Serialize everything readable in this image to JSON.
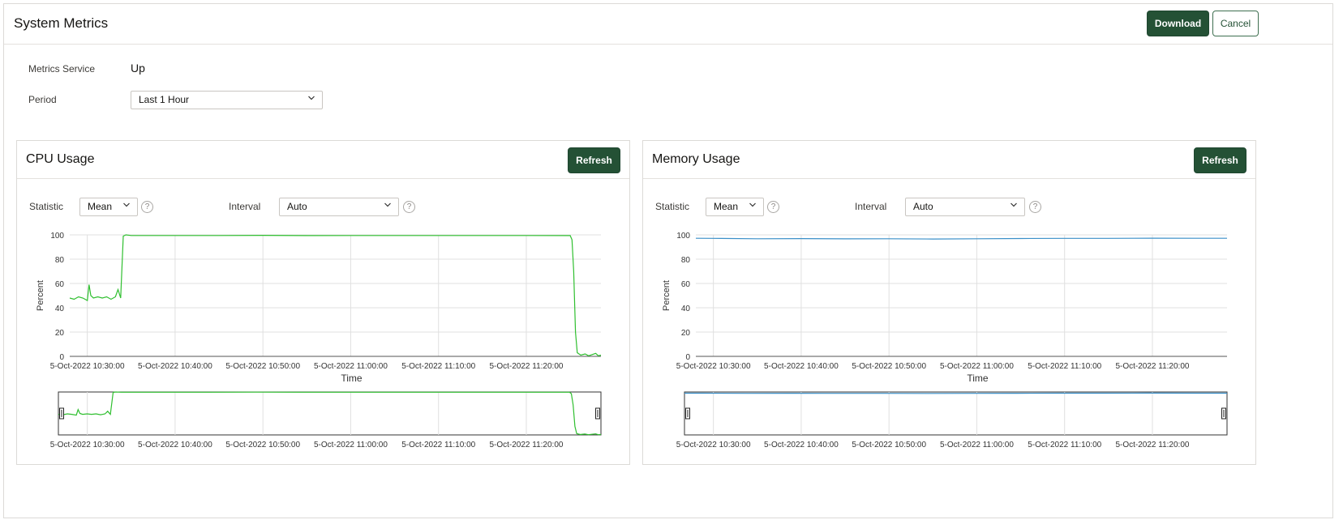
{
  "header": {
    "title": "System Metrics",
    "download_label": "Download",
    "cancel_label": "Cancel"
  },
  "info": {
    "service_label": "Metrics Service",
    "service_value": "Up",
    "period_label": "Period",
    "period_value": "Last 1 Hour"
  },
  "colors": {
    "primary": "#245135",
    "cpu_line": "#2fbf2f",
    "memory_line": "#3a8fc8",
    "grid": "#e0e0e0"
  },
  "icons": {
    "dropdown": "chevron-down-icon",
    "help": "question-circle-icon"
  },
  "panels": [
    {
      "title": "CPU Usage",
      "refresh_label": "Refresh",
      "statistic_label": "Statistic",
      "statistic_value": "Mean",
      "interval_label": "Interval",
      "interval_value": "Auto",
      "help_glyph": "?"
    },
    {
      "title": "Memory Usage",
      "refresh_label": "Refresh",
      "statistic_label": "Statistic",
      "statistic_value": "Mean",
      "interval_label": "Interval",
      "interval_value": "Auto",
      "help_glyph": "?"
    }
  ],
  "chart_data": [
    {
      "type": "line",
      "title": "",
      "xlabel": "Time",
      "ylabel": "Percent",
      "ylim": [
        0,
        100
      ],
      "yticks": [
        0,
        20,
        40,
        60,
        80,
        100
      ],
      "xlim_minutes": [
        -2,
        58.5
      ],
      "xticks": [
        {
          "label": "5-Oct-2022 10:30:00",
          "minute": 0
        },
        {
          "label": "5-Oct-2022 10:40:00",
          "minute": 10
        },
        {
          "label": "5-Oct-2022 10:50:00",
          "minute": 20
        },
        {
          "label": "5-Oct-2022 11:00:00",
          "minute": 30
        },
        {
          "label": "5-Oct-2022 11:10:00",
          "minute": 40
        },
        {
          "label": "5-Oct-2022 11:20:00",
          "minute": 50
        }
      ],
      "grid": true,
      "series": [
        {
          "color": "#2fbf2f",
          "points": [
            [
              -2,
              48
            ],
            [
              -1.5,
              47
            ],
            [
              -1,
              49
            ],
            [
              -0.5,
              48
            ],
            [
              0,
              46
            ],
            [
              0.2,
              59
            ],
            [
              0.4,
              50
            ],
            [
              0.7,
              48
            ],
            [
              1.2,
              49
            ],
            [
              1.7,
              48
            ],
            [
              2.2,
              49
            ],
            [
              2.7,
              47
            ],
            [
              3.2,
              49
            ],
            [
              3.5,
              55
            ],
            [
              3.8,
              48
            ],
            [
              4.1,
              99
            ],
            [
              4.4,
              100
            ],
            [
              5,
              99.5
            ],
            [
              10,
              99.5
            ],
            [
              15,
              99.5
            ],
            [
              20,
              99.6
            ],
            [
              25,
              99.4
            ],
            [
              30,
              99.5
            ],
            [
              35,
              99.5
            ],
            [
              40,
              99.5
            ],
            [
              45,
              99.5
            ],
            [
              50,
              99.5
            ],
            [
              55,
              99.4
            ],
            [
              55.2,
              96
            ],
            [
              55.4,
              70
            ],
            [
              55.6,
              20
            ],
            [
              55.8,
              3
            ],
            [
              56.2,
              1
            ],
            [
              56.7,
              2
            ],
            [
              57.1,
              0.5
            ],
            [
              57.5,
              1.5
            ],
            [
              57.9,
              2.5
            ],
            [
              58.2,
              0.5
            ],
            [
              58.5,
              1
            ]
          ]
        }
      ]
    },
    {
      "type": "line",
      "title": "",
      "xlabel": "Time",
      "ylabel": "Percent",
      "ylim": [
        0,
        100
      ],
      "yticks": [
        0,
        20,
        40,
        60,
        80,
        100
      ],
      "xlim_minutes": [
        -2,
        58.5
      ],
      "xticks": [
        {
          "label": "5-Oct-2022 10:30:00",
          "minute": 0
        },
        {
          "label": "5-Oct-2022 10:40:00",
          "minute": 10
        },
        {
          "label": "5-Oct-2022 10:50:00",
          "minute": 20
        },
        {
          "label": "5-Oct-2022 11:00:00",
          "minute": 30
        },
        {
          "label": "5-Oct-2022 11:10:00",
          "minute": 40
        },
        {
          "label": "5-Oct-2022 11:20:00",
          "minute": 50
        }
      ],
      "grid": true,
      "series": [
        {
          "color": "#3a8fc8",
          "points": [
            [
              -2,
              97.2
            ],
            [
              0,
              97.1
            ],
            [
              5,
              96.8
            ],
            [
              10,
              96.9
            ],
            [
              15,
              96.7
            ],
            [
              20,
              96.8
            ],
            [
              25,
              96.6
            ],
            [
              30,
              96.8
            ],
            [
              35,
              97.0
            ],
            [
              40,
              97.1
            ],
            [
              45,
              97.1
            ],
            [
              50,
              97.3
            ],
            [
              55,
              97.2
            ],
            [
              58.5,
              97.2
            ]
          ]
        }
      ]
    }
  ]
}
